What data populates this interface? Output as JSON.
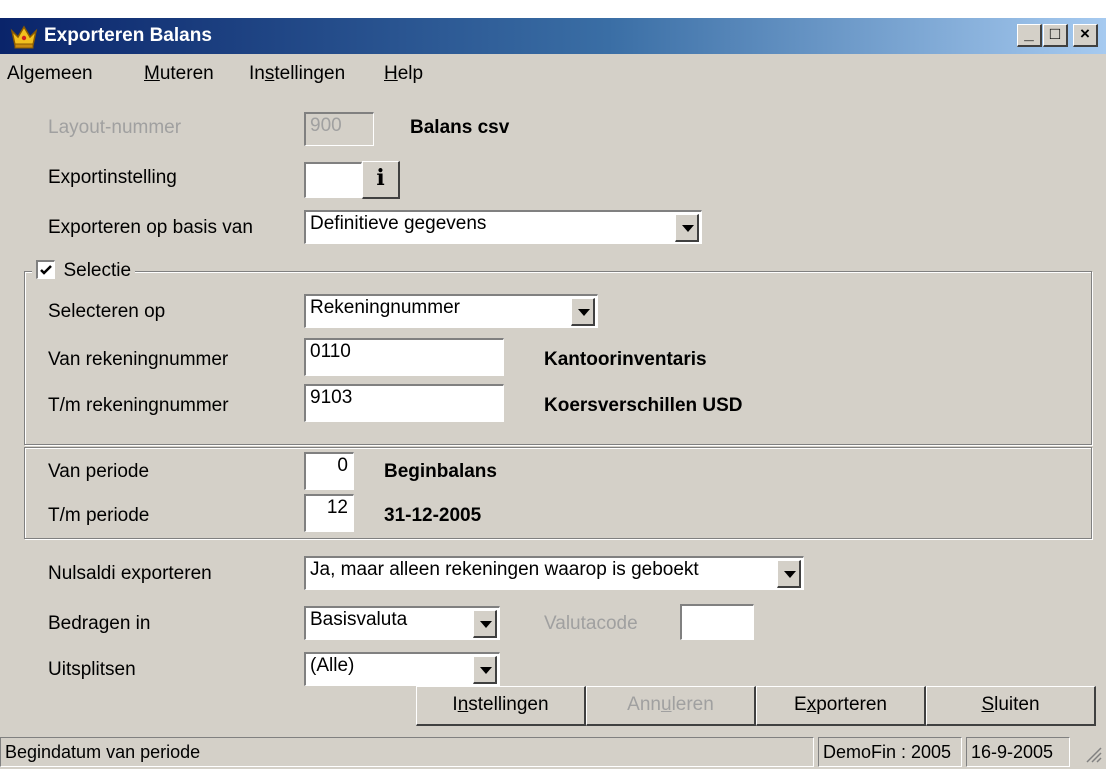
{
  "window": {
    "title": "Exporteren Balans",
    "controls": {
      "minimize": "_",
      "maximize": "□",
      "close": "×"
    }
  },
  "menu": [
    {
      "pre": "Al",
      "u": "g",
      "post": "emeen"
    },
    {
      "pre": "",
      "u": "M",
      "post": "uteren"
    },
    {
      "pre": "In",
      "u": "s",
      "post": "tellingen"
    },
    {
      "pre": "",
      "u": "H",
      "post": "elp"
    }
  ],
  "form": {
    "layout_label": "Layout-nummer",
    "layout_value": "900",
    "layout_name": "Balans csv",
    "exportinstelling_label": "Exportinstelling",
    "exportinstelling_value": "",
    "info_glyph": "i",
    "basis_label": "Exporteren op basis van",
    "basis_value": "Definitieve gegevens"
  },
  "selectie": {
    "legend": "Selectie",
    "checked": true,
    "selecteren_op_label": "Selecteren op",
    "selecteren_op_value": "Rekeningnummer",
    "van_label": "Van rekeningnummer",
    "van_value": "0110",
    "van_name": "Kantoorinventaris",
    "tm_label": "T/m rekeningnummer",
    "tm_value": "9103",
    "tm_name": "Koersverschillen USD"
  },
  "periode": {
    "van_label": "Van periode",
    "van_value": "0",
    "van_name": "Beginbalans",
    "tm_label": "T/m periode",
    "tm_value": "12",
    "tm_name": "31-12-2005"
  },
  "options": {
    "nulsaldi_label": "Nulsaldi exporteren",
    "nulsaldi_value": "Ja, maar alleen rekeningen waarop is geboekt",
    "bedragen_label": "Bedragen in",
    "bedragen_value": "Basisvaluta",
    "valutacode_label": "Valutacode",
    "valutacode_value": "",
    "uitsplitsen_label": "Uitsplitsen",
    "uitsplitsen_value": "(Alle)"
  },
  "buttons": [
    {
      "pre": "I",
      "u": "n",
      "post": "stellingen",
      "enabled": true
    },
    {
      "pre": "Ann",
      "u": "u",
      "post": "leren",
      "enabled": false
    },
    {
      "pre": "E",
      "u": "x",
      "post": "porteren",
      "enabled": true
    },
    {
      "pre": "",
      "u": "S",
      "post": "luiten",
      "enabled": true
    }
  ],
  "status": {
    "message": "Begindatum van periode",
    "company": "DemoFin : 2005",
    "date": "16-9-2005"
  },
  "colors": {
    "title_gradient_start": "#0a246a",
    "title_gradient_end": "#a6caf0",
    "window_face": "#d4d0c8",
    "disabled_text": "#a0a0a0"
  },
  "icons": {
    "app": "crown-icon",
    "info": "info-icon",
    "dropdown": "chevron-down-icon",
    "check": "checkmark-icon",
    "resize": "resize-grip-icon"
  }
}
